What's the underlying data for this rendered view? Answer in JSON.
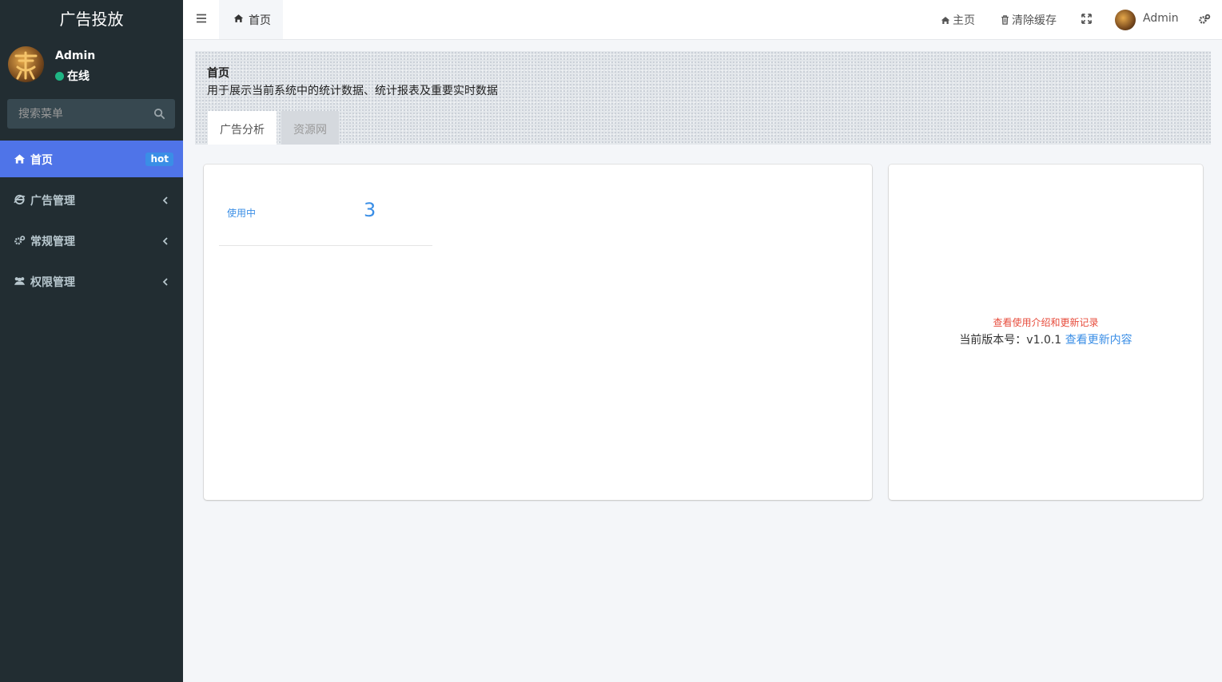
{
  "sidebar": {
    "logo": "广告投放",
    "user": {
      "name": "Admin",
      "status": "在线"
    },
    "search": {
      "placeholder": "搜索菜单"
    },
    "menu": [
      {
        "label": "首页",
        "icon": "home-icon",
        "badge": "hot",
        "active": true
      },
      {
        "label": "广告管理",
        "icon": "internet-explorer-icon",
        "active": false
      },
      {
        "label": "常规管理",
        "icon": "cogs-icon",
        "active": false
      },
      {
        "label": "权限管理",
        "icon": "group-icon",
        "active": false
      }
    ]
  },
  "header": {
    "home_tab": "首页",
    "links": {
      "home": "主页",
      "clear_cache": "清除缓存",
      "user": "Admin"
    }
  },
  "content": {
    "title": "首页",
    "description": "用于展示当前系统中的统计数据、统计报表及重要实时数据",
    "tabs": [
      {
        "label": "广告分析",
        "active": true
      },
      {
        "label": "资源网",
        "active": false
      }
    ],
    "stats": {
      "label": "使用中",
      "value": "3"
    },
    "info": {
      "intro_link": "查看使用介绍和更新记录",
      "version_prefix": "当前版本号：v1.0.1",
      "version_link": "查看更新内容"
    }
  },
  "colors": {
    "sidebar_bg": "#222d32",
    "active_menu": "#4f74e8",
    "accent_blue": "#3a8ee6",
    "intro_red": "#e74c3c",
    "online_green": "#1fb584"
  }
}
